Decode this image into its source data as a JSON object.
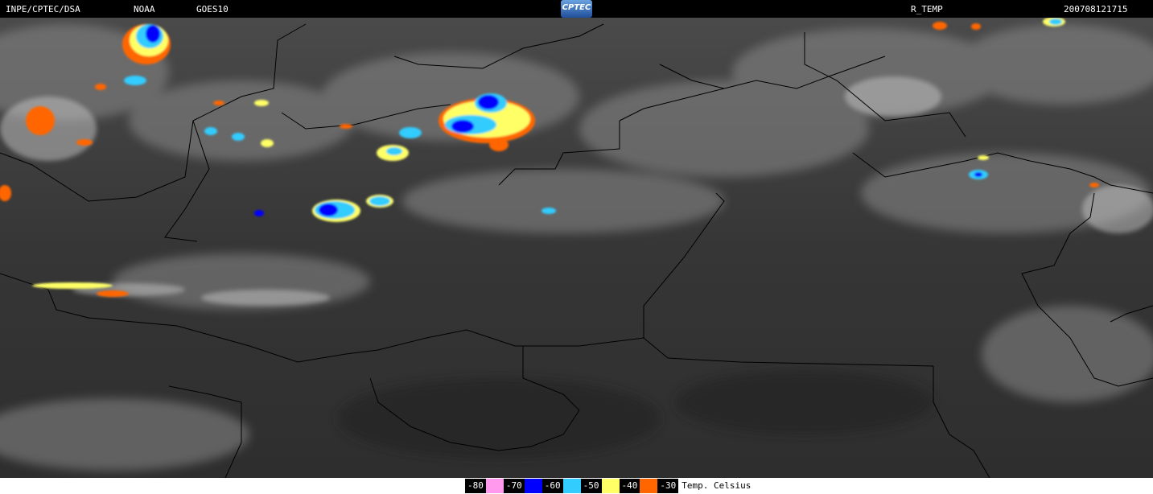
{
  "header": {
    "org": "INPE/CPTEC/DSA",
    "agency": "NOAA",
    "satellite": "GOES10",
    "logo_text": "CPTEC",
    "product": "R_TEMP",
    "timestamp": "200708121715"
  },
  "legend": {
    "entries": [
      {
        "label": "-80",
        "color": "#ff99ee"
      },
      {
        "label": "-70",
        "color": "#0000ff"
      },
      {
        "label": "-60",
        "color": "#33ccff"
      },
      {
        "label": "-50",
        "color": "#ffff66"
      },
      {
        "label": "-40",
        "color": "#ff6600"
      },
      {
        "label": "-30",
        "color": ""
      }
    ],
    "unit": "Temp. Celsius"
  },
  "colors": {
    "background": "#000000",
    "land": "#3a3a3a",
    "cloud": "#bdbdbd",
    "border": "#000000"
  }
}
